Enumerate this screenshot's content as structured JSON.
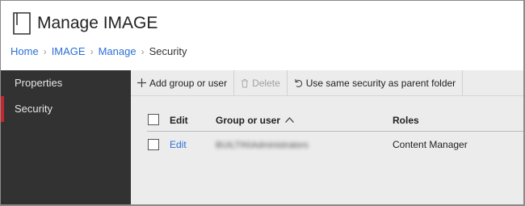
{
  "header": {
    "title": "Manage IMAGE",
    "icon": "document-icon"
  },
  "breadcrumb": [
    {
      "label": "Home",
      "link": true
    },
    {
      "label": "IMAGE",
      "link": true
    },
    {
      "label": "Manage",
      "link": true
    },
    {
      "label": "Security",
      "link": false
    }
  ],
  "sidebar": {
    "items": [
      {
        "label": "Properties",
        "active": false
      },
      {
        "label": "Security",
        "active": true
      }
    ],
    "accent_color": "#c4262e"
  },
  "toolbar": {
    "add_label": "Add group or user",
    "delete_label": "Delete",
    "revert_label": "Use same security as parent folder"
  },
  "table": {
    "columns": {
      "edit": "Edit",
      "group": "Group or user",
      "roles": "Roles"
    },
    "rows": [
      {
        "edit": "Edit",
        "group": "BUILTIN\\Administrators",
        "roles": "Content Manager"
      }
    ]
  },
  "colors": {
    "link": "#2b6fd6",
    "sidebar_bg": "#323232",
    "content_bg": "#ececec"
  }
}
